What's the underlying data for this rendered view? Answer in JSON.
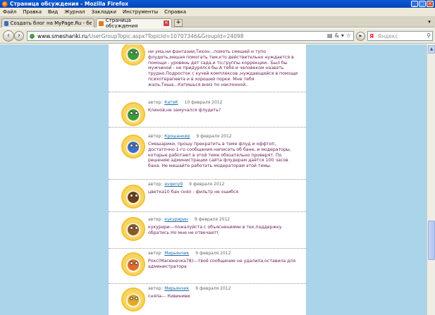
{
  "window": {
    "title": "Страница обсуждения - Mozilla Firefox"
  },
  "menu": [
    "Файл",
    "Правка",
    "Вид",
    "Журнал",
    "Закладки",
    "Инструменты",
    "Справка"
  ],
  "tabs": [
    {
      "label": "Создать блог на MyPage.Ru - бесплат...",
      "active": false
    },
    {
      "label": "Страница обсуждения",
      "active": true
    }
  ],
  "nav": {
    "back_icon": "back-arrow-icon",
    "forward_icon": "forward-arrow-icon",
    "url_domain": "www.smeshariki.ru",
    "url_path": "/UserGroupTopic.aspx?TopicId=10707346&GroupId=24098",
    "search_placeholder": "Яндекс"
  },
  "posts": [
    {
      "author": "",
      "date": "",
      "text": "ни ума,ни фантазии,Тихон...помоть смешей и тупо флудить,мешая помогать тем,кто действительно нуждается в помощи - уровень дет сада,и то,группы коррекции.. Был бы мужчиной - не придурялся бы.А тебя и человеком назвать трудно.Подросток с кучей комплексов ,нуждающийся в помощи психотерапевта и в хорошей порке. Мне тебя жаль,Тиша...Катишься вниз по наклонной.."
    },
    {
      "author": "КатяК",
      "date": "10 февраля 2012",
      "text": "Клинов,не замучался флудить?"
    },
    {
      "author": "Крошанкир",
      "date": "9 февраля 2012",
      "text": "Смешарики, прошу прекратить в теме флуд и оффтоп, достаточно 1-го сообщения написать об бане, и модераторы, которые работают в этой теме обязательно проверят. По решению администрации сайта флудерам даётся 100 часов бана. Не мешайте работать модераторам этой темы."
    },
    {
      "author": "evgeny9",
      "date": "9 февраля 2012",
      "text": "цветка10 бан снял - фильтр не ошибся"
    },
    {
      "author": "кукуририн",
      "date": "9 февраля 2012",
      "text": "кукурири---пожалуйста с объяснениями в тех.поддержку обратись  Но мне не отвечают("
    },
    {
      "author": "Мирьянчик",
      "date": "9 февраля 2012",
      "text": "Рокс(Масюнечка78)---твоё сообщение не удалила,оставила для администратора"
    },
    {
      "author": "Мирьянчик",
      "date": "9 февраля 2012",
      "text": "сняла--- Кивиниви"
    }
  ],
  "labels": {
    "author_prefix": "автор:"
  },
  "colors": {
    "titlebar": "#0a5bd5",
    "background": "#aad4ea",
    "post_text": "#6a1a58",
    "author_link": "#1a6ea8",
    "avatar_ring": "#f2c232"
  }
}
